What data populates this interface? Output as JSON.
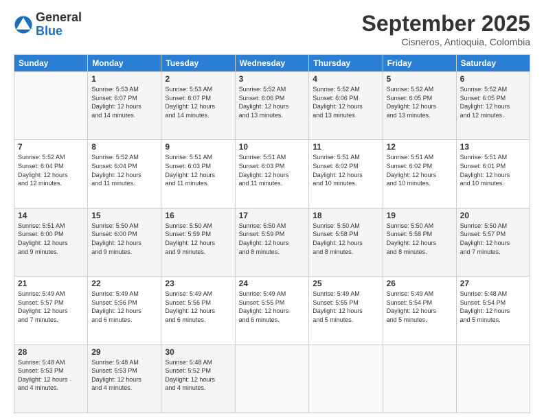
{
  "logo": {
    "general": "General",
    "blue": "Blue"
  },
  "header": {
    "month": "September 2025",
    "location": "Cisneros, Antioquia, Colombia"
  },
  "weekdays": [
    "Sunday",
    "Monday",
    "Tuesday",
    "Wednesday",
    "Thursday",
    "Friday",
    "Saturday"
  ],
  "weeks": [
    [
      {
        "day": null
      },
      {
        "day": "1",
        "sunrise": "5:53 AM",
        "sunset": "6:07 PM",
        "daylight": "12 hours and 14 minutes."
      },
      {
        "day": "2",
        "sunrise": "5:53 AM",
        "sunset": "6:07 PM",
        "daylight": "12 hours and 14 minutes."
      },
      {
        "day": "3",
        "sunrise": "5:52 AM",
        "sunset": "6:06 PM",
        "daylight": "12 hours and 13 minutes."
      },
      {
        "day": "4",
        "sunrise": "5:52 AM",
        "sunset": "6:06 PM",
        "daylight": "12 hours and 13 minutes."
      },
      {
        "day": "5",
        "sunrise": "5:52 AM",
        "sunset": "6:05 PM",
        "daylight": "12 hours and 13 minutes."
      },
      {
        "day": "6",
        "sunrise": "5:52 AM",
        "sunset": "6:05 PM",
        "daylight": "12 hours and 12 minutes."
      }
    ],
    [
      {
        "day": "7",
        "sunrise": "5:52 AM",
        "sunset": "6:04 PM",
        "daylight": "12 hours and 12 minutes."
      },
      {
        "day": "8",
        "sunrise": "5:52 AM",
        "sunset": "6:04 PM",
        "daylight": "12 hours and 11 minutes."
      },
      {
        "day": "9",
        "sunrise": "5:51 AM",
        "sunset": "6:03 PM",
        "daylight": "12 hours and 11 minutes."
      },
      {
        "day": "10",
        "sunrise": "5:51 AM",
        "sunset": "6:03 PM",
        "daylight": "12 hours and 11 minutes."
      },
      {
        "day": "11",
        "sunrise": "5:51 AM",
        "sunset": "6:02 PM",
        "daylight": "12 hours and 10 minutes."
      },
      {
        "day": "12",
        "sunrise": "5:51 AM",
        "sunset": "6:02 PM",
        "daylight": "12 hours and 10 minutes."
      },
      {
        "day": "13",
        "sunrise": "5:51 AM",
        "sunset": "6:01 PM",
        "daylight": "12 hours and 10 minutes."
      }
    ],
    [
      {
        "day": "14",
        "sunrise": "5:51 AM",
        "sunset": "6:00 PM",
        "daylight": "12 hours and 9 minutes."
      },
      {
        "day": "15",
        "sunrise": "5:50 AM",
        "sunset": "6:00 PM",
        "daylight": "12 hours and 9 minutes."
      },
      {
        "day": "16",
        "sunrise": "5:50 AM",
        "sunset": "5:59 PM",
        "daylight": "12 hours and 9 minutes."
      },
      {
        "day": "17",
        "sunrise": "5:50 AM",
        "sunset": "5:59 PM",
        "daylight": "12 hours and 8 minutes."
      },
      {
        "day": "18",
        "sunrise": "5:50 AM",
        "sunset": "5:58 PM",
        "daylight": "12 hours and 8 minutes."
      },
      {
        "day": "19",
        "sunrise": "5:50 AM",
        "sunset": "5:58 PM",
        "daylight": "12 hours and 8 minutes."
      },
      {
        "day": "20",
        "sunrise": "5:50 AM",
        "sunset": "5:57 PM",
        "daylight": "12 hours and 7 minutes."
      }
    ],
    [
      {
        "day": "21",
        "sunrise": "5:49 AM",
        "sunset": "5:57 PM",
        "daylight": "12 hours and 7 minutes."
      },
      {
        "day": "22",
        "sunrise": "5:49 AM",
        "sunset": "5:56 PM",
        "daylight": "12 hours and 6 minutes."
      },
      {
        "day": "23",
        "sunrise": "5:49 AM",
        "sunset": "5:56 PM",
        "daylight": "12 hours and 6 minutes."
      },
      {
        "day": "24",
        "sunrise": "5:49 AM",
        "sunset": "5:55 PM",
        "daylight": "12 hours and 6 minutes."
      },
      {
        "day": "25",
        "sunrise": "5:49 AM",
        "sunset": "5:55 PM",
        "daylight": "12 hours and 5 minutes."
      },
      {
        "day": "26",
        "sunrise": "5:49 AM",
        "sunset": "5:54 PM",
        "daylight": "12 hours and 5 minutes."
      },
      {
        "day": "27",
        "sunrise": "5:48 AM",
        "sunset": "5:54 PM",
        "daylight": "12 hours and 5 minutes."
      }
    ],
    [
      {
        "day": "28",
        "sunrise": "5:48 AM",
        "sunset": "5:53 PM",
        "daylight": "12 hours and 4 minutes."
      },
      {
        "day": "29",
        "sunrise": "5:48 AM",
        "sunset": "5:53 PM",
        "daylight": "12 hours and 4 minutes."
      },
      {
        "day": "30",
        "sunrise": "5:48 AM",
        "sunset": "5:52 PM",
        "daylight": "12 hours and 4 minutes."
      },
      {
        "day": null
      },
      {
        "day": null
      },
      {
        "day": null
      },
      {
        "day": null
      }
    ]
  ]
}
